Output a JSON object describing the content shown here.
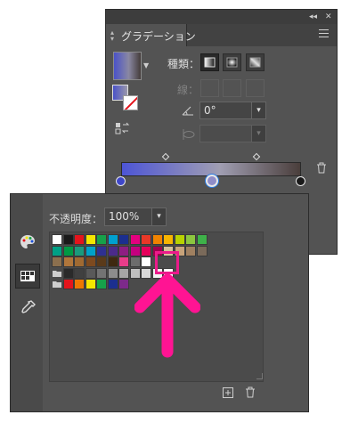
{
  "gradient_panel": {
    "title": "グラデーション",
    "type_label": "種類：",
    "stroke_label": "線：",
    "angle_value": "0°",
    "aspect_value": "",
    "stop_colors": [
      "#3f47c9",
      "#8f8dc9",
      "#1a1a1a"
    ]
  },
  "swatch_panel": {
    "opacity_label": "不透明度：",
    "opacity_value": "100%",
    "rows": [
      [
        "#ffffff",
        "#1a1a1a",
        "#e5141c",
        "#f4e600",
        "#16a14a",
        "#00a0cf",
        "#1b2f8f",
        "#e4007f",
        "#e83828",
        "#f08300",
        "#f8b500",
        "#b8d200",
        "#8cc63f",
        "#3eb149"
      ],
      [
        "#00a085",
        "#009944",
        "#1a9a7c",
        "#00a2c8",
        "#2e3092",
        "#4b2a8a",
        "#8e1e82",
        "#c5007f",
        "#e6005b",
        "#a0004f",
        "#d7c29a",
        "#c8a37a",
        "#a08060",
        "#7a6a5a"
      ],
      [
        "#8b6f4e",
        "#b0763b",
        "#a06a32",
        "#7d4a1f",
        "#5a3a1a",
        "#3e2810",
        "#e83d8a",
        "#6c6c6c",
        "#ffffff"
      ],
      [
        "#2a2a2a",
        "#404040",
        "#595959",
        "#737373",
        "#8c8c8c",
        "#a6a6a6",
        "#bfbfbf",
        "#d9d9d9",
        "#f2f2f2",
        "#ffffff"
      ],
      [
        "#e5141c",
        "#ee7800",
        "#f4e600",
        "#16a14a",
        "#1b2f8f",
        "#7d2a8a"
      ]
    ]
  },
  "colors": {
    "highlight": "#ec1b8b",
    "arrow": "#ff1493"
  }
}
